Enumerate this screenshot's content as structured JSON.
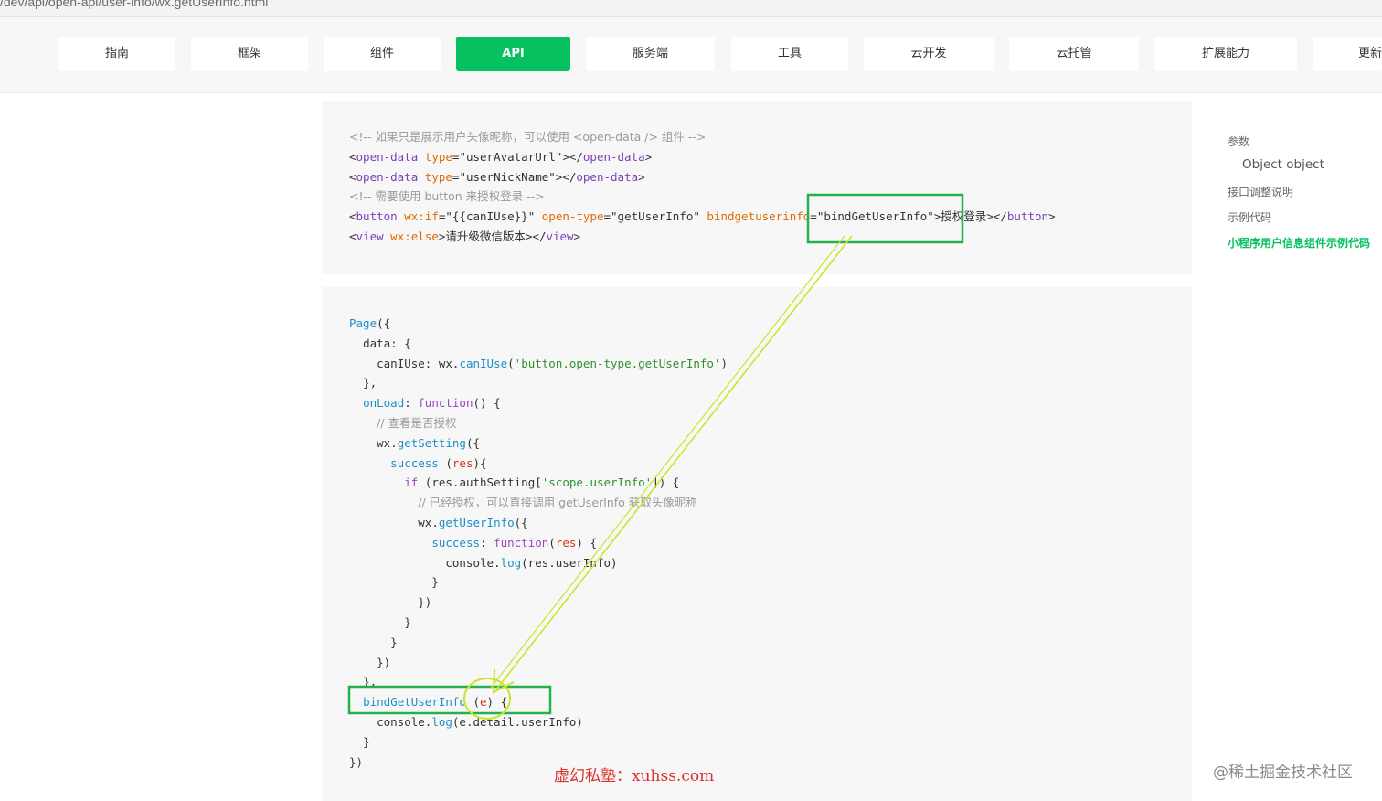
{
  "browser": {
    "url": "/dev/api/open-api/user-info/wx.getUserInfo.html"
  },
  "nav": {
    "tabs": [
      {
        "label": "指南"
      },
      {
        "label": "框架"
      },
      {
        "label": "组件"
      },
      {
        "label": "API",
        "active": true
      },
      {
        "label": "服务端"
      },
      {
        "label": "工具"
      },
      {
        "label": "云开发"
      },
      {
        "label": "云托管"
      },
      {
        "label": "扩展能力"
      },
      {
        "label": "更新"
      }
    ],
    "accent_color": "#07c160"
  },
  "toc": {
    "items": [
      {
        "label": "参数"
      },
      {
        "label": "Object object"
      },
      {
        "label": "接口调整说明"
      },
      {
        "label": "示例代码"
      },
      {
        "label": "小程序用户信息组件示例代码"
      }
    ]
  },
  "code_wxml": {
    "l1_comment": "<!-- 如果只是展示用户头像昵称，可以使用 <open-data /> 组件 -->",
    "l2_open": "<",
    "l2_tag": "open-data",
    "l2_attr": "type",
    "l2_eq": "=",
    "l2_val": "\"userAvatarUrl\"",
    "l2_mid": "></",
    "l2_tag2": "open-data",
    "l2_close": ">",
    "l3_val": "\"userNickName\"",
    "l4_comment": "<!-- 需要使用 button 来授权登录 -->",
    "l5_tag": "button",
    "l5_attr1": "wx:if",
    "l5_val1": "\"{{canIUse}}\"",
    "l5_attr2": "open-type",
    "l5_val2": "\"getUserInfo\"",
    "l5_attr3": "bindgetuserinfo",
    "l5_val3": "\"bindGetUserInfo\"",
    "l5_text": "授权登录",
    "l6_tag": "view",
    "l6_attr": "wx:else",
    "l6_text": "请升级微信版本"
  },
  "code_js": {
    "page": "Page",
    "data_key": "data",
    "caniuse_key": "canIUse",
    "wx": "wx",
    "caniuse_fn": "canIUse",
    "caniuse_arg": "'button.open-type.getUserInfo'",
    "onload": "onLoad",
    "function_kw": "function",
    "comment1": "// 查看是否授权",
    "getsetting": "getSetting",
    "success": "success",
    "res": "res",
    "if_kw": "if",
    "authsetting": "res.authSetting[",
    "scope": "'scope.userInfo'",
    "comment2": "// 已经授权，可以直接调用 getUserInfo 获取头像昵称",
    "getuserinfo": "getUserInfo",
    "console": "console",
    "log": "log",
    "resuserinfo": "(res.userInfo)",
    "handler": "bindGetUserInfo",
    "e_param": "e",
    "detail": "(e.detail.userInfo)"
  },
  "annotations": {
    "box_color": "#22b14c",
    "arrow_color": "#c8e62a"
  },
  "watermarks": {
    "red": "虚幻私塾：xuhss.com",
    "juejin": "@稀土掘金技术社区"
  }
}
